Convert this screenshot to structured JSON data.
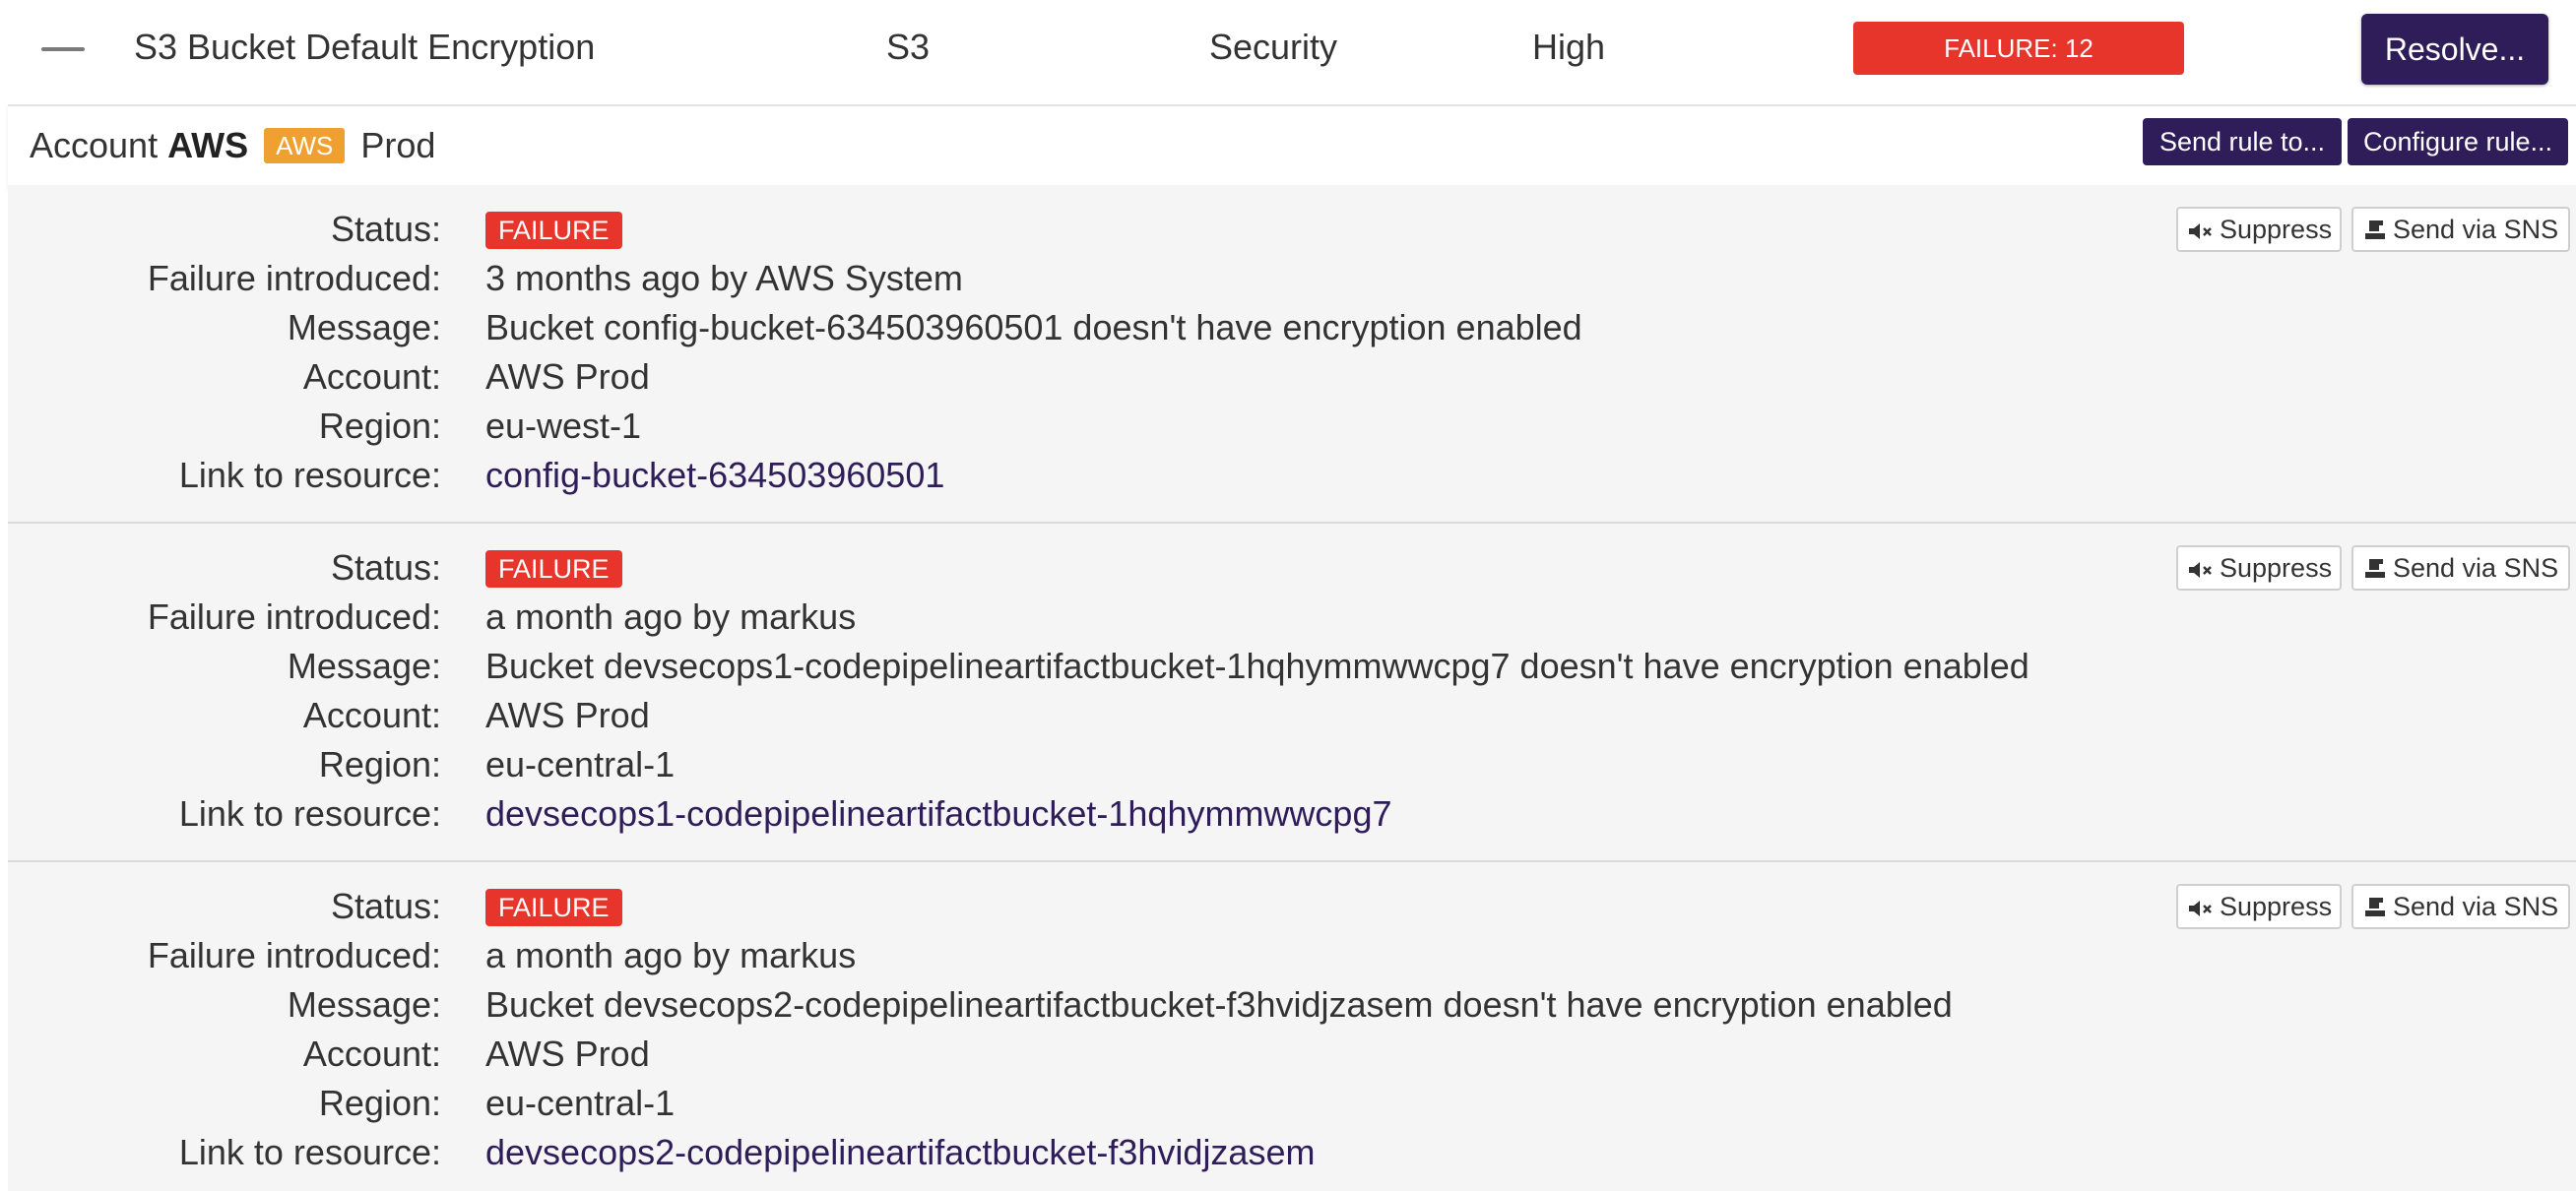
{
  "rule": {
    "name": "S3 Bucket Default Encryption",
    "service": "S3",
    "category": "Security",
    "risk": "High",
    "failure_count_label": "FAILURE: 12",
    "resolve_label": "Resolve..."
  },
  "account": {
    "prefix": "Account",
    "name": "AWS",
    "provider_badge": "AWS",
    "environment": "Prod",
    "send_rule_label": "Send rule to...",
    "configure_rule_label": "Configure rule..."
  },
  "labels": {
    "status": "Status:",
    "failure_introduced": "Failure introduced:",
    "message": "Message:",
    "account": "Account:",
    "region": "Region:",
    "link": "Link to resource:",
    "suppress": "Suppress",
    "send_sns": "Send via SNS"
  },
  "colors": {
    "brand_purple": "#2f1d5a",
    "failure_red": "#e8352b",
    "aws_orange": "#f0a030"
  },
  "icons": {
    "collapse": "minus-icon",
    "suppress": "mute-speaker-icon",
    "sns": "send-export-icon"
  },
  "entries": [
    {
      "status": "FAILURE",
      "failure_introduced": "3 months ago by AWS System",
      "message": "Bucket config-bucket-634503960501 doesn't have encryption enabled",
      "account": "AWS Prod",
      "region": "eu-west-1",
      "link": "config-bucket-634503960501"
    },
    {
      "status": "FAILURE",
      "failure_introduced": "a month ago by markus",
      "message": "Bucket devsecops1-codepipelineartifactbucket-1hqhymmwwcpg7 doesn't have encryption enabled",
      "account": "AWS Prod",
      "region": "eu-central-1",
      "link": "devsecops1-codepipelineartifactbucket-1hqhymmwwcpg7"
    },
    {
      "status": "FAILURE",
      "failure_introduced": "a month ago by markus",
      "message": "Bucket devsecops2-codepipelineartifactbucket-f3hvidjzasem doesn't have encryption enabled",
      "account": "AWS Prod",
      "region": "eu-central-1",
      "link": "devsecops2-codepipelineartifactbucket-f3hvidjzasem"
    }
  ]
}
